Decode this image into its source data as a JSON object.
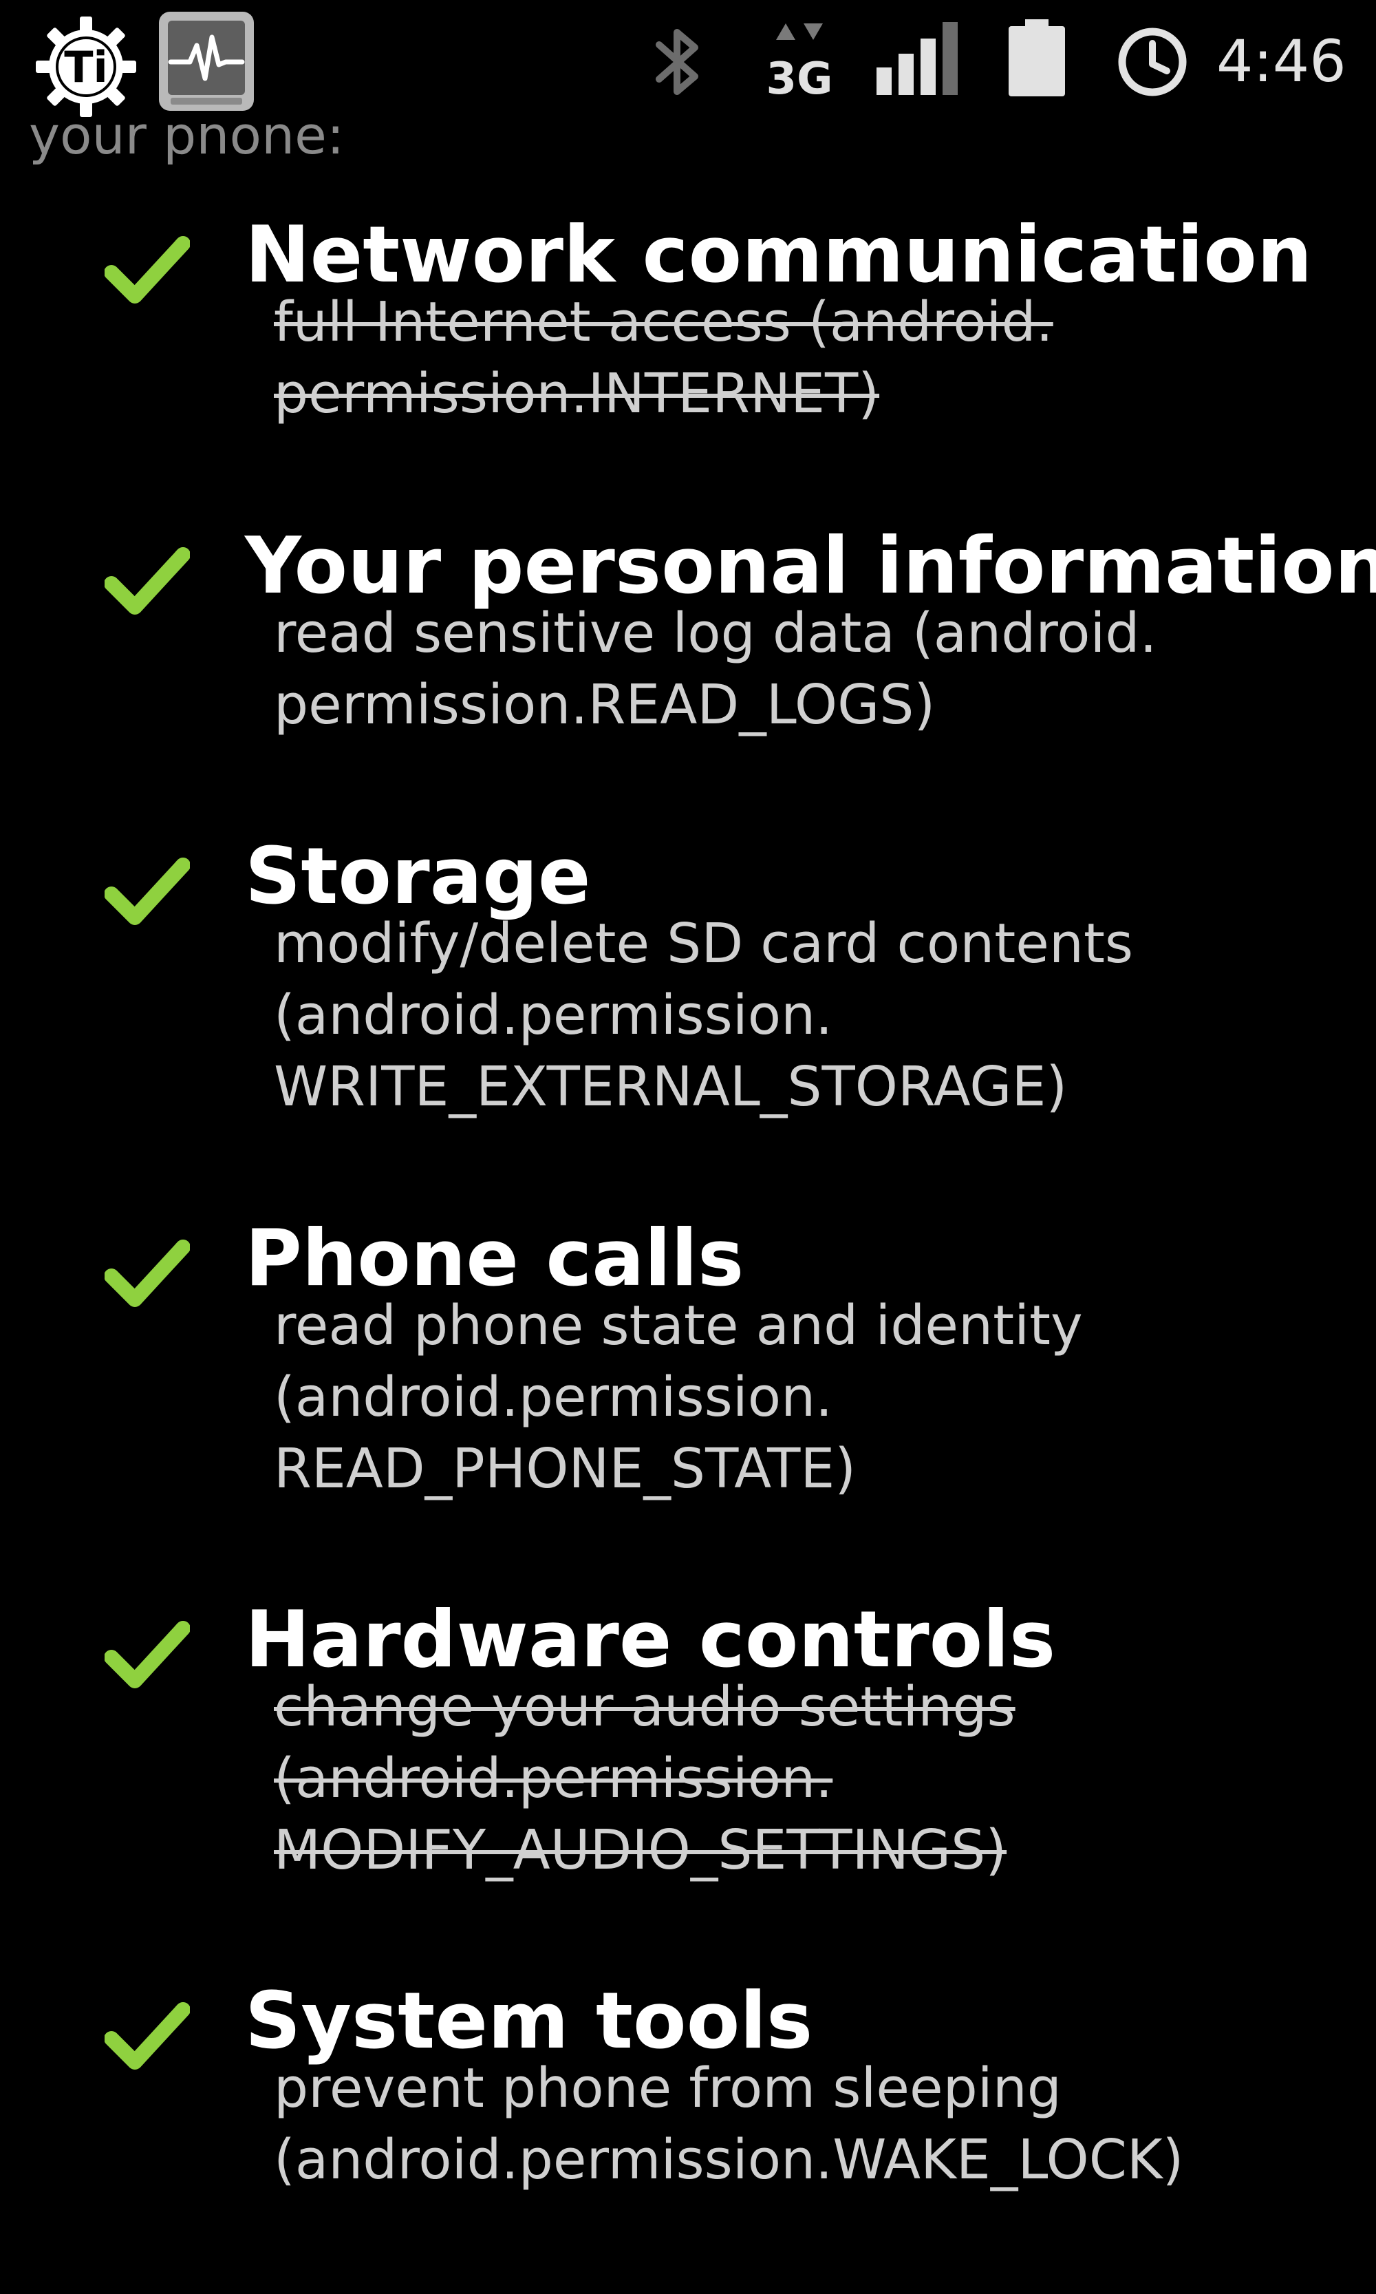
{
  "status_bar": {
    "time": "4:46",
    "network_type": "3G",
    "icons": [
      "titanium-backup-icon",
      "system-monitor-icon",
      "bluetooth-icon",
      "3g-data-icon",
      "signal-strength-icon",
      "battery-icon",
      "alarm-clock-icon"
    ],
    "accent_color": "#e2e2e2"
  },
  "header_cut_text": "your phone:",
  "check_color": "#8fd13f",
  "groups": [
    {
      "title": "Network communication",
      "permission": {
        "lines": [
          "full Internet access (android.",
          "permission.INTERNET)"
        ],
        "revoked": true
      }
    },
    {
      "title": "Your personal information",
      "permission": {
        "lines": [
          "read sensitive log data (android.",
          "permission.READ_LOGS)"
        ],
        "revoked": false
      }
    },
    {
      "title": "Storage",
      "permission": {
        "lines": [
          "modify/delete SD card contents",
          "(android.permission.",
          "WRITE_EXTERNAL_STORAGE)"
        ],
        "revoked": false
      }
    },
    {
      "title": "Phone calls",
      "permission": {
        "lines": [
          "read phone state and identity",
          "(android.permission.",
          "READ_PHONE_STATE)"
        ],
        "revoked": false
      }
    },
    {
      "title": "Hardware controls",
      "permission": {
        "lines": [
          "change your audio settings",
          "(android.permission.",
          "MODIFY_AUDIO_SETTINGS)"
        ],
        "revoked": true
      }
    },
    {
      "title": "System tools",
      "permission": {
        "lines": [
          "prevent phone from sleeping",
          "(android.permission.WAKE_LOCK)"
        ],
        "revoked": false
      }
    }
  ]
}
